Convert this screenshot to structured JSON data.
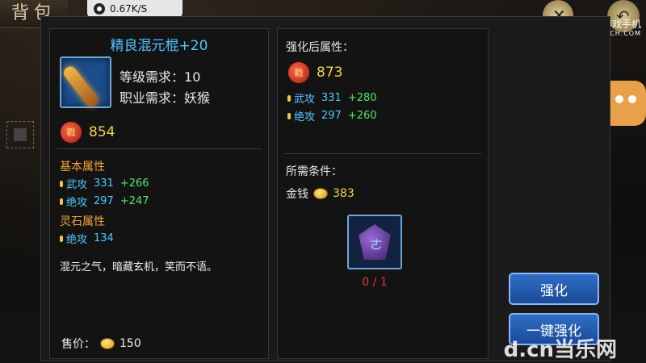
{
  "background": {
    "title": "背包"
  },
  "status_bar": {
    "network_speed": "0.67K/S"
  },
  "item": {
    "name": "精良混元棍+20",
    "level_label": "等级需求：",
    "level_value": "10",
    "class_label": "职业需求：",
    "class_value": "妖猴",
    "power_value": "854"
  },
  "base_attributes": {
    "title": "基本属性",
    "stats": [
      {
        "name": "武攻",
        "value": "331",
        "bonus": "+266"
      },
      {
        "name": "绝攻",
        "value": "297",
        "bonus": "+247"
      }
    ]
  },
  "stone_attributes": {
    "title": "灵石属性",
    "stats": [
      {
        "name": "绝攻",
        "value": "134"
      }
    ]
  },
  "description": "混元之气，暗藏玄机，笑而不语。",
  "sell": {
    "label": "售价：",
    "value": "150"
  },
  "after_upgrade": {
    "title": "强化后属性：",
    "power_value": "873",
    "stats": [
      {
        "name": "武攻",
        "value": "331",
        "bonus": "+280"
      },
      {
        "name": "绝攻",
        "value": "297",
        "bonus": "+260"
      }
    ]
  },
  "requirements": {
    "title": "所需条件：",
    "gold_label": "金钱",
    "gold_value": "383",
    "material_count": "0 / 1"
  },
  "buttons": {
    "upgrade": "强化",
    "one_click_upgrade": "一键强化"
  },
  "watermark": {
    "line1": "来自摩奇游戏手机",
    "line2": "IMUCH.COM",
    "footer": "d.cn当乐网"
  },
  "icons": {
    "power_icon": "戳",
    "material_glyph": "ㄜ"
  }
}
